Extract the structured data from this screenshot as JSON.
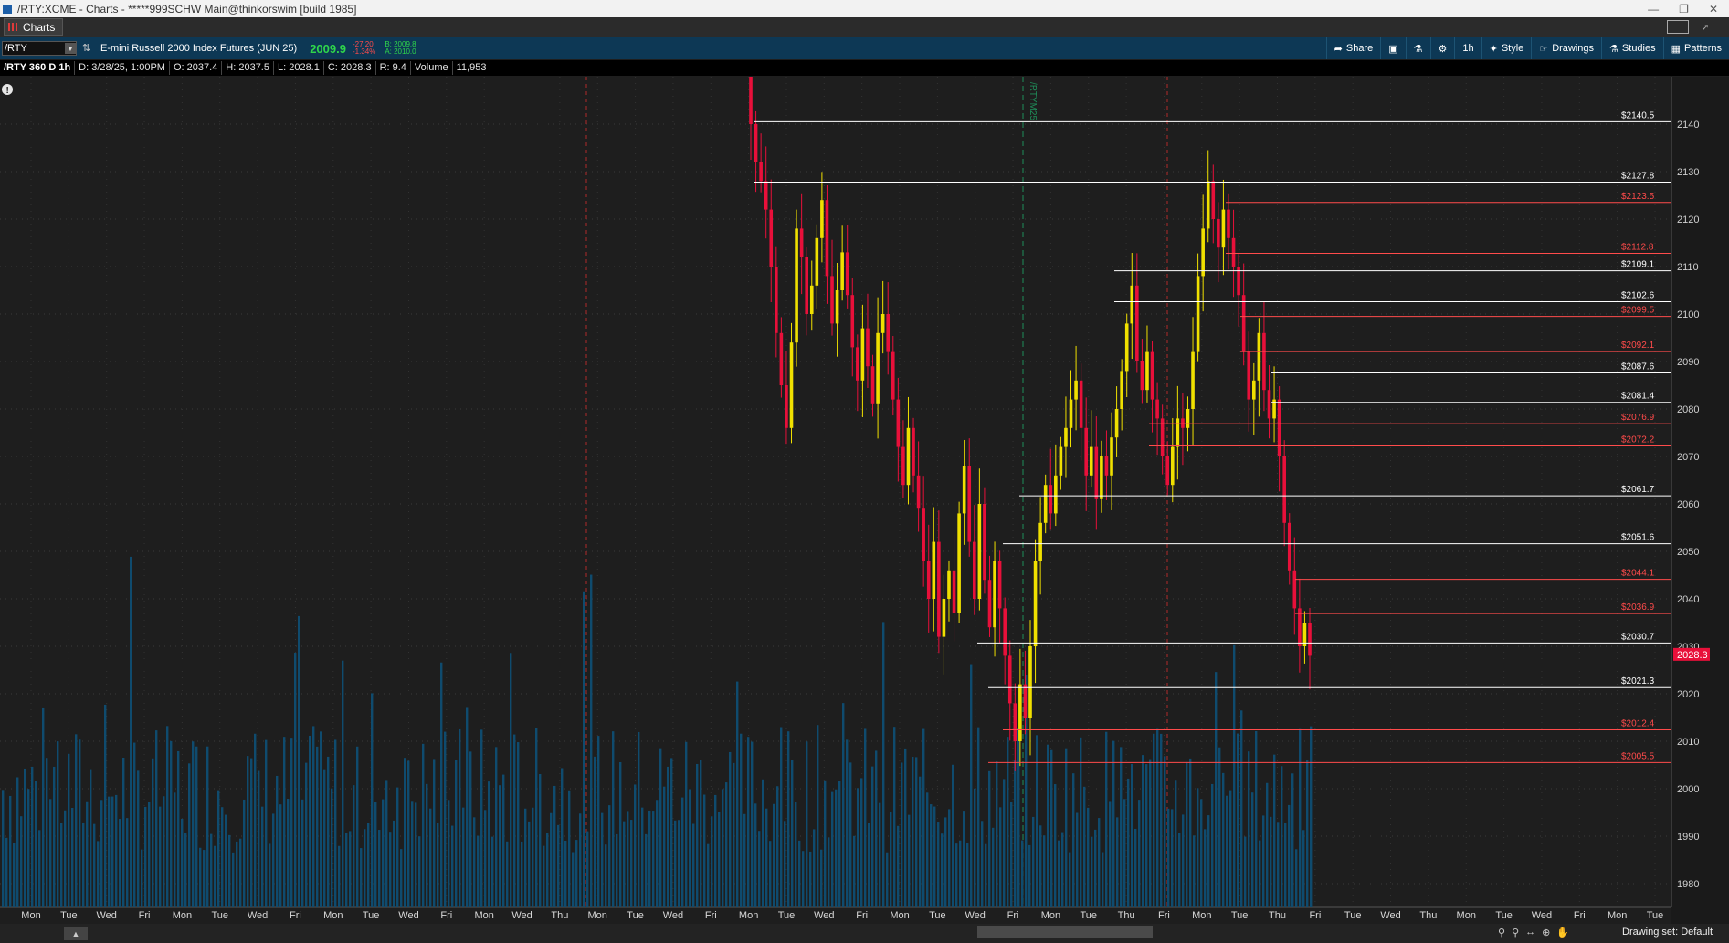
{
  "window": {
    "title": "/RTY:XCME - Charts - *****999SCHW Main@thinkorswim [build 1985]"
  },
  "tab": {
    "label": "Charts"
  },
  "toolbar": {
    "symbol": "/RTY",
    "description": "E-mini Russell 2000 Index Futures (JUN 25)",
    "last": "2009.9",
    "change": "-27.20",
    "change_pct": "-1.34%",
    "bid": "B: 2009.8",
    "ask": "A: 2010.0",
    "share": "Share",
    "period": "1h",
    "style": "Style",
    "drawings": "Drawings",
    "studies": "Studies",
    "patterns": "Patterns"
  },
  "infobar": {
    "label": "/RTY 360 D 1h",
    "date": "D: 3/28/25, 1:00PM",
    "open": "O: 2037.4",
    "high": "H: 2037.5",
    "low": "L: 2028.1",
    "close": "C: 2028.3",
    "range": "R: 9.4",
    "volume_label": "Volume",
    "volume": "11,953"
  },
  "footer": {
    "drawing_set": "Drawing set: Default"
  },
  "chart_data": {
    "type": "candlestick",
    "timeframe": "1h",
    "days": 360,
    "ylim": [
      1975,
      2150
    ],
    "y_ticks": [
      1980,
      1990,
      2000,
      2010,
      2020,
      2030,
      2040,
      2050,
      2060,
      2070,
      2080,
      2090,
      2100,
      2110,
      2120,
      2130,
      2140
    ],
    "current_price": "2028.3",
    "contract_marker": "/RTYM25",
    "colors": {
      "up": "#f0e000",
      "down": "#e8103a",
      "volume": "#0f4b6e",
      "support": "#ffffff",
      "resistance": "#ff4b4b",
      "price_tag": "#e8103a"
    },
    "levels": [
      {
        "label": "$2140.5",
        "value": 2140.5,
        "kind": "white"
      },
      {
        "label": "$2127.8",
        "value": 2127.8,
        "kind": "white"
      },
      {
        "label": "$2123.5",
        "value": 2123.5,
        "kind": "red"
      },
      {
        "label": "$2112.8",
        "value": 2112.8,
        "kind": "red"
      },
      {
        "label": "$2109.1",
        "value": 2109.1,
        "kind": "white"
      },
      {
        "label": "$2102.6",
        "value": 2102.6,
        "kind": "white"
      },
      {
        "label": "$2099.5",
        "value": 2099.5,
        "kind": "red"
      },
      {
        "label": "$2092.1",
        "value": 2092.1,
        "kind": "red"
      },
      {
        "label": "$2087.6",
        "value": 2087.6,
        "kind": "white"
      },
      {
        "label": "$2081.4",
        "value": 2081.4,
        "kind": "white"
      },
      {
        "label": "$2076.9",
        "value": 2076.9,
        "kind": "red"
      },
      {
        "label": "$2072.2",
        "value": 2072.2,
        "kind": "red"
      },
      {
        "label": "$2061.7",
        "value": 2061.7,
        "kind": "white"
      },
      {
        "label": "$2051.6",
        "value": 2051.6,
        "kind": "white"
      },
      {
        "label": "$2044.1",
        "value": 2044.1,
        "kind": "red"
      },
      {
        "label": "$2036.9",
        "value": 2036.9,
        "kind": "red"
      },
      {
        "label": "$2030.7",
        "value": 2030.7,
        "kind": "white"
      },
      {
        "label": "$2021.3",
        "value": 2021.3,
        "kind": "white"
      },
      {
        "label": "$2012.4",
        "value": 2012.4,
        "kind": "red"
      },
      {
        "label": "$2005.5",
        "value": 2005.5,
        "kind": "red"
      }
    ],
    "x_labels": [
      "Mon",
      "Tue",
      "Wed",
      "Fri",
      "Mon",
      "Tue",
      "Wed",
      "Fri",
      "Mon",
      "Tue",
      "Wed",
      "Fri",
      "Mon",
      "Wed",
      "Thu",
      "Mon",
      "Tue",
      "Wed",
      "Fri",
      "Mon",
      "Tue",
      "Wed",
      "Fri",
      "Mon",
      "Tue",
      "Wed",
      "Fri",
      "Mon",
      "Tue",
      "Thu",
      "Fri",
      "Mon",
      "Tue",
      "Thu",
      "Fri",
      "Tue",
      "Wed",
      "Thu",
      "Mon",
      "Tue",
      "Wed",
      "Fri",
      "Mon",
      "Tue"
    ],
    "closes": [
      2140,
      2132,
      2128,
      2122,
      2110,
      2096,
      2085,
      2076,
      2094,
      2118,
      2112,
      2100,
      2106,
      2116,
      2124,
      2108,
      2098,
      2105,
      2113,
      2104,
      2093,
      2086,
      2097,
      2089,
      2081,
      2096,
      2100,
      2092,
      2082,
      2072,
      2064,
      2076,
      2066,
      2059,
      2048,
      2040,
      2052,
      2032,
      2040,
      2046,
      2037,
      2058,
      2068,
      2052,
      2040,
      2060,
      2044,
      2034,
      2048,
      2038,
      2028,
      2018,
      2010,
      2022,
      2015,
      2030,
      2048,
      2056,
      2064,
      2058,
      2066,
      2072,
      2076,
      2082,
      2086,
      2076,
      2066,
      2072,
      2061,
      2070,
      2066,
      2074,
      2080,
      2088,
      2098,
      2106,
      2090,
      2084,
      2092,
      2082,
      2078,
      2070,
      2064,
      2072,
      2078,
      2076,
      2080,
      2092,
      2108,
      2118,
      2128,
      2120,
      2114,
      2122,
      2116,
      2110,
      2104,
      2092,
      2082,
      2086,
      2096,
      2084,
      2078,
      2082,
      2070,
      2056,
      2046,
      2038,
      2030,
      2035,
      2028
    ]
  }
}
